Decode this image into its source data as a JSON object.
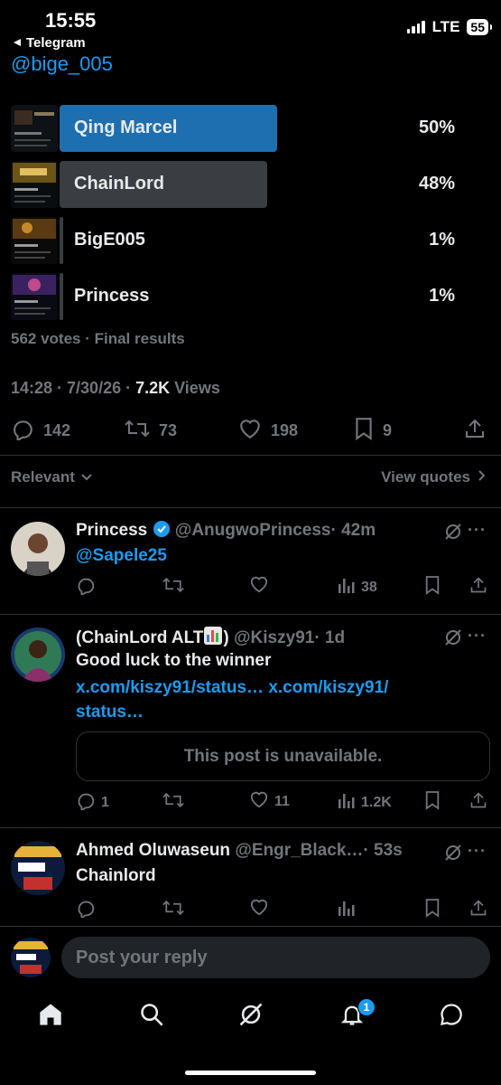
{
  "status": {
    "time": "15:55",
    "back_app": "Telegram",
    "network": "LTE",
    "battery": "55"
  },
  "tweet": {
    "mention": "@bige_005",
    "poll": [
      {
        "label": "Qing Marcel",
        "percent": "50%",
        "fill": 0.5,
        "color": "#1d6fb0",
        "winner": true
      },
      {
        "label": "ChainLord",
        "percent": "48%",
        "fill": 0.48,
        "color": "#3a3d41",
        "winner": false
      },
      {
        "label": "BigE005",
        "percent": "1%",
        "fill": 0.01,
        "color": "#3a3d41",
        "winner": false
      },
      {
        "label": "Princess",
        "percent": "1%",
        "fill": 0.01,
        "color": "#3a3d41",
        "winner": false
      }
    ],
    "votes": "562 votes · Final results",
    "timestamp": "14:28 · 7/30/26 · ",
    "views_count": "7.2K",
    "views_label": " Views",
    "replies": "142",
    "reposts": "73",
    "likes": "198",
    "bookmarks": "9"
  },
  "sort": {
    "label": "Relevant",
    "view_quotes": "View quotes"
  },
  "replies": [
    {
      "name": "Princess",
      "verified": true,
      "handle": "@AnugwoPrincess",
      "time": "· 42m",
      "text": "@Sapele25",
      "views": "38",
      "replies": "",
      "likes": ""
    },
    {
      "name": "(ChainLord ALT",
      "name_end": ")",
      "handle": "@Kiszy91",
      "time": "· 1d",
      "text": "Good luck to the winner",
      "link1": "x.com/kiszy91/status…",
      "link2": "x.com/kiszy91/",
      "link3": "status…",
      "unavailable": "This post is unavailable.",
      "replies": "1",
      "likes": "11",
      "views": "1.2K"
    },
    {
      "name": "Ahmed Oluwaseun",
      "handle": "@Engr_Black…",
      "time": "· 53s",
      "text": "Chainlord"
    }
  ],
  "composer": {
    "placeholder": "Post your reply"
  },
  "tabbar": {
    "notifications_badge": "1"
  },
  "colors": {
    "accent": "#1d9bf0",
    "muted": "#71767b",
    "text": "#e7e9ea",
    "winner_bar": "#1d6fb0"
  }
}
